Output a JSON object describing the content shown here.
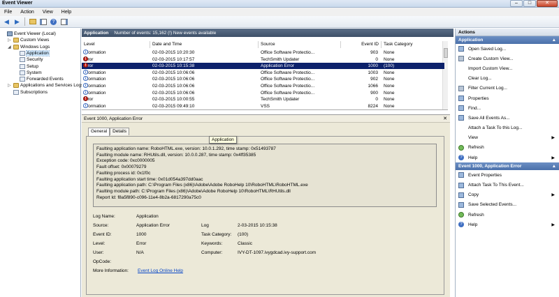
{
  "window": {
    "title": "Event Viewer",
    "buttons": [
      "–",
      "□",
      "✕"
    ]
  },
  "menu": [
    "File",
    "Action",
    "View",
    "Help"
  ],
  "tree": [
    {
      "label": "Event Viewer (Local)",
      "indent": 0,
      "icon": "ev",
      "arrow": ""
    },
    {
      "label": "Custom Views",
      "indent": 1,
      "icon": "folder",
      "arrow": "▷"
    },
    {
      "label": "Windows Logs",
      "indent": 1,
      "icon": "folder",
      "arrow": "◢"
    },
    {
      "label": "Application",
      "indent": 2,
      "icon": "log",
      "arrow": "",
      "selected": true
    },
    {
      "label": "Security",
      "indent": 2,
      "icon": "log",
      "arrow": ""
    },
    {
      "label": "Setup",
      "indent": 2,
      "icon": "log",
      "arrow": ""
    },
    {
      "label": "System",
      "indent": 2,
      "icon": "log",
      "arrow": ""
    },
    {
      "label": "Forwarded Events",
      "indent": 2,
      "icon": "log",
      "arrow": ""
    },
    {
      "label": "Applications and Services Logs",
      "indent": 1,
      "icon": "folder",
      "arrow": "▷"
    },
    {
      "label": "Subscriptions",
      "indent": 1,
      "icon": "log",
      "arrow": ""
    }
  ],
  "center": {
    "log_name": "Application",
    "event_count": "Number of events: 15,162 (!) New events available"
  },
  "columns": [
    "Level",
    "Date and Time",
    "Source",
    "Event ID",
    "Task Category"
  ],
  "events": [
    {
      "level": "Information",
      "datetime": "02-03-2015 10:20:30",
      "source": "Office Software Protectio...",
      "id": "903",
      "task": "None"
    },
    {
      "level": "Error",
      "datetime": "02-03-2015 10:17:57",
      "source": "TechSmith Updater",
      "id": "0",
      "task": "None"
    },
    {
      "level": "Error",
      "datetime": "02-03-2015 10:15:38",
      "source": "Application Error",
      "id": "1000",
      "task": "(100)",
      "selected": true
    },
    {
      "level": "Information",
      "datetime": "02-03-2015 10:06:06",
      "source": "Office Software Protectio...",
      "id": "1003",
      "task": "None"
    },
    {
      "level": "Information",
      "datetime": "02-03-2015 10:06:06",
      "source": "Office Software Protectio...",
      "id": "902",
      "task": "None"
    },
    {
      "level": "Information",
      "datetime": "02-03-2015 10:06:06",
      "source": "Office Software Protectio...",
      "id": "1066",
      "task": "None"
    },
    {
      "level": "Information",
      "datetime": "02-03-2015 10:06:06",
      "source": "Office Software Protectio...",
      "id": "900",
      "task": "None"
    },
    {
      "level": "Error",
      "datetime": "02-03-2015 10:00:55",
      "source": "TechSmith Updater",
      "id": "0",
      "task": "None"
    },
    {
      "level": "Information",
      "datetime": "02-03-2015 09:49:10",
      "source": "VSS",
      "id": "8224",
      "task": "None"
    }
  ],
  "detail": {
    "title": "Event 1000, Application Error",
    "tabs": [
      "General",
      "Details"
    ],
    "message": [
      "Faulting application name: RoboHTML.exe, version: 10.0.1.292, time stamp: 0x51493787",
      "Faulting module name: RHUtils.dll, version: 10.0.0.287, time stamp: 0x4ff35385",
      "Exception code: 0xc0000005",
      "Fault offset: 0x00079279",
      "Faulting process id: 0x1f0c",
      "Faulting application start time: 0x01d054a397dd0aac",
      "Faulting application path: C:\\Program Files (x86)\\Adobe\\Adobe RoboHelp 10\\RoboHTML\\RoboHTML.exe",
      "Faulting module path: C:\\Program Files (x86)\\Adobe\\Adobe RoboHelp 10\\RoboHTML\\RHUtils.dll",
      "Report Id: f8a5f890-c096-11e4-8b2a-6817290a75c0"
    ],
    "labels": {
      "log_name": "Log Name:",
      "source": "Source:",
      "event_id": "Event ID:",
      "level": "Level:",
      "user": "User:",
      "opcode": "OpCode:",
      "more_info": "More Information:",
      "logged": "Log",
      "task_category": "Task Category:",
      "keywords": "Keywords:",
      "computer": "Computer:"
    },
    "values": {
      "log_name": "Application",
      "source": "Application Error",
      "event_id": "1000",
      "level": "Error",
      "user": "N/A",
      "opcode": "",
      "more_info_link": "Event Log Online Help",
      "logged": "2-03-2015 10:15:38",
      "task_category": "(100)",
      "keywords": "Classic",
      "computer": "IVY-DT-1097.ivygdcad.ivy-support.com"
    },
    "tooltip": "Application"
  },
  "actions": {
    "header": "Actions",
    "section1": "Application",
    "items1": [
      {
        "label": "Open Saved Log...",
        "icon": "blue"
      },
      {
        "label": "Create Custom View...",
        "icon": "filter"
      },
      {
        "label": "Import Custom View...",
        "icon": "none"
      },
      {
        "label": "Clear Log...",
        "icon": "none"
      },
      {
        "label": "Filter Current Log...",
        "icon": "filter"
      },
      {
        "label": "Properties",
        "icon": "blue"
      },
      {
        "label": "Find...",
        "icon": "blue"
      },
      {
        "label": "Save All Events As...",
        "icon": "blue"
      },
      {
        "label": "Attach a Task To this Log...",
        "icon": "none"
      },
      {
        "label": "View",
        "icon": "none",
        "submenu": true
      },
      {
        "label": "Refresh",
        "icon": "green"
      },
      {
        "label": "Help",
        "icon": "help",
        "submenu": true
      }
    ],
    "section2": "Event 1000, Application Error",
    "items2": [
      {
        "label": "Event Properties",
        "icon": "blue"
      },
      {
        "label": "Attach Task To This Event...",
        "icon": "blue"
      },
      {
        "label": "Copy",
        "icon": "blue",
        "submenu": true
      },
      {
        "label": "Save Selected Events...",
        "icon": "blue"
      },
      {
        "label": "Refresh",
        "icon": "green"
      },
      {
        "label": "Help",
        "icon": "help",
        "submenu": true
      }
    ]
  }
}
